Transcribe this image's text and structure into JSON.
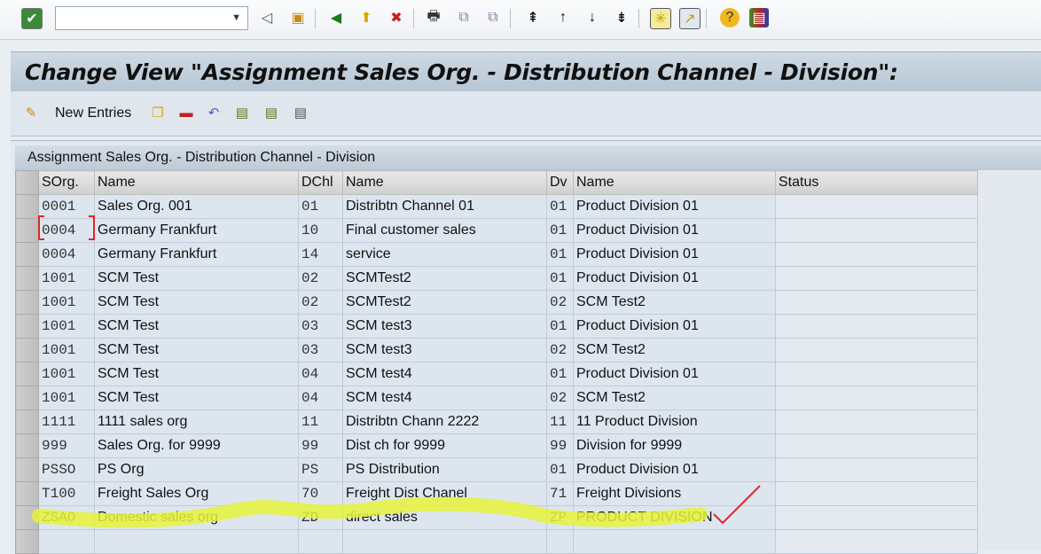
{
  "system_toolbar": {
    "command_field": "",
    "icons": [
      "enter-icon",
      "back-icon",
      "save-icon",
      "back-green-icon",
      "exit-icon",
      "cancel-icon",
      "print-icon",
      "find-icon",
      "find-next-icon",
      "first-page-icon",
      "previous-page-icon",
      "next-page-icon",
      "last-page-icon",
      "new-session-icon",
      "shortcut-icon",
      "help-icon",
      "layout-icon"
    ]
  },
  "title": "Change View \"Assignment Sales Org. - Distribution Channel - Division\":",
  "app_toolbar": {
    "new_entries": "New Entries"
  },
  "table": {
    "group_title": "Assignment Sales Org. - Distribution Channel - Division",
    "columns": [
      "SOrg.",
      "Name",
      "DChl",
      "Name",
      "Dv",
      "Name",
      "Status"
    ],
    "rows": [
      [
        "0001",
        "Sales Org. 001",
        "01",
        "Distribtn Channel 01",
        "01",
        "Product Division 01",
        ""
      ],
      [
        "0004",
        "Germany Frankfurt",
        "10",
        "Final customer sales",
        "01",
        "Product Division 01",
        ""
      ],
      [
        "0004",
        "Germany Frankfurt",
        "14",
        "service",
        "01",
        "Product Division 01",
        ""
      ],
      [
        "1001",
        "SCM Test",
        "02",
        "SCMTest2",
        "01",
        "Product Division 01",
        ""
      ],
      [
        "1001",
        "SCM Test",
        "02",
        "SCMTest2",
        "02",
        "SCM Test2",
        ""
      ],
      [
        "1001",
        "SCM Test",
        "03",
        "SCM test3",
        "01",
        "Product Division 01",
        ""
      ],
      [
        "1001",
        "SCM Test",
        "03",
        "SCM test3",
        "02",
        "SCM Test2",
        ""
      ],
      [
        "1001",
        "SCM Test",
        "04",
        "SCM test4",
        "01",
        "Product Division 01",
        ""
      ],
      [
        "1001",
        "SCM Test",
        "04",
        "SCM test4",
        "02",
        "SCM Test2",
        ""
      ],
      [
        "1111",
        "1111 sales org",
        "11",
        "Distribtn Chann 2222",
        "11",
        "11 Product Division",
        ""
      ],
      [
        "999",
        "Sales Org. for 9999",
        "99",
        "Dist ch for 9999",
        "99",
        "Division for  9999",
        ""
      ],
      [
        "PSSO",
        "PS Org",
        "PS",
        "PS Distribution",
        "01",
        "Product Division 01",
        ""
      ],
      [
        "T100",
        "Freight Sales Org",
        "70",
        "Freight Dist Chanel",
        "71",
        "Freight Divisions",
        ""
      ],
      [
        "ZSAO",
        "Domestic sales org",
        "ZD",
        "direct sales",
        "ZP",
        "PRODUCT DIVISION",
        ""
      ],
      [
        "",
        "",
        "",
        "",
        "",
        "",
        ""
      ]
    ]
  },
  "colors": {
    "highlight": "#e6f23a",
    "checkmark": "#e0262a"
  }
}
